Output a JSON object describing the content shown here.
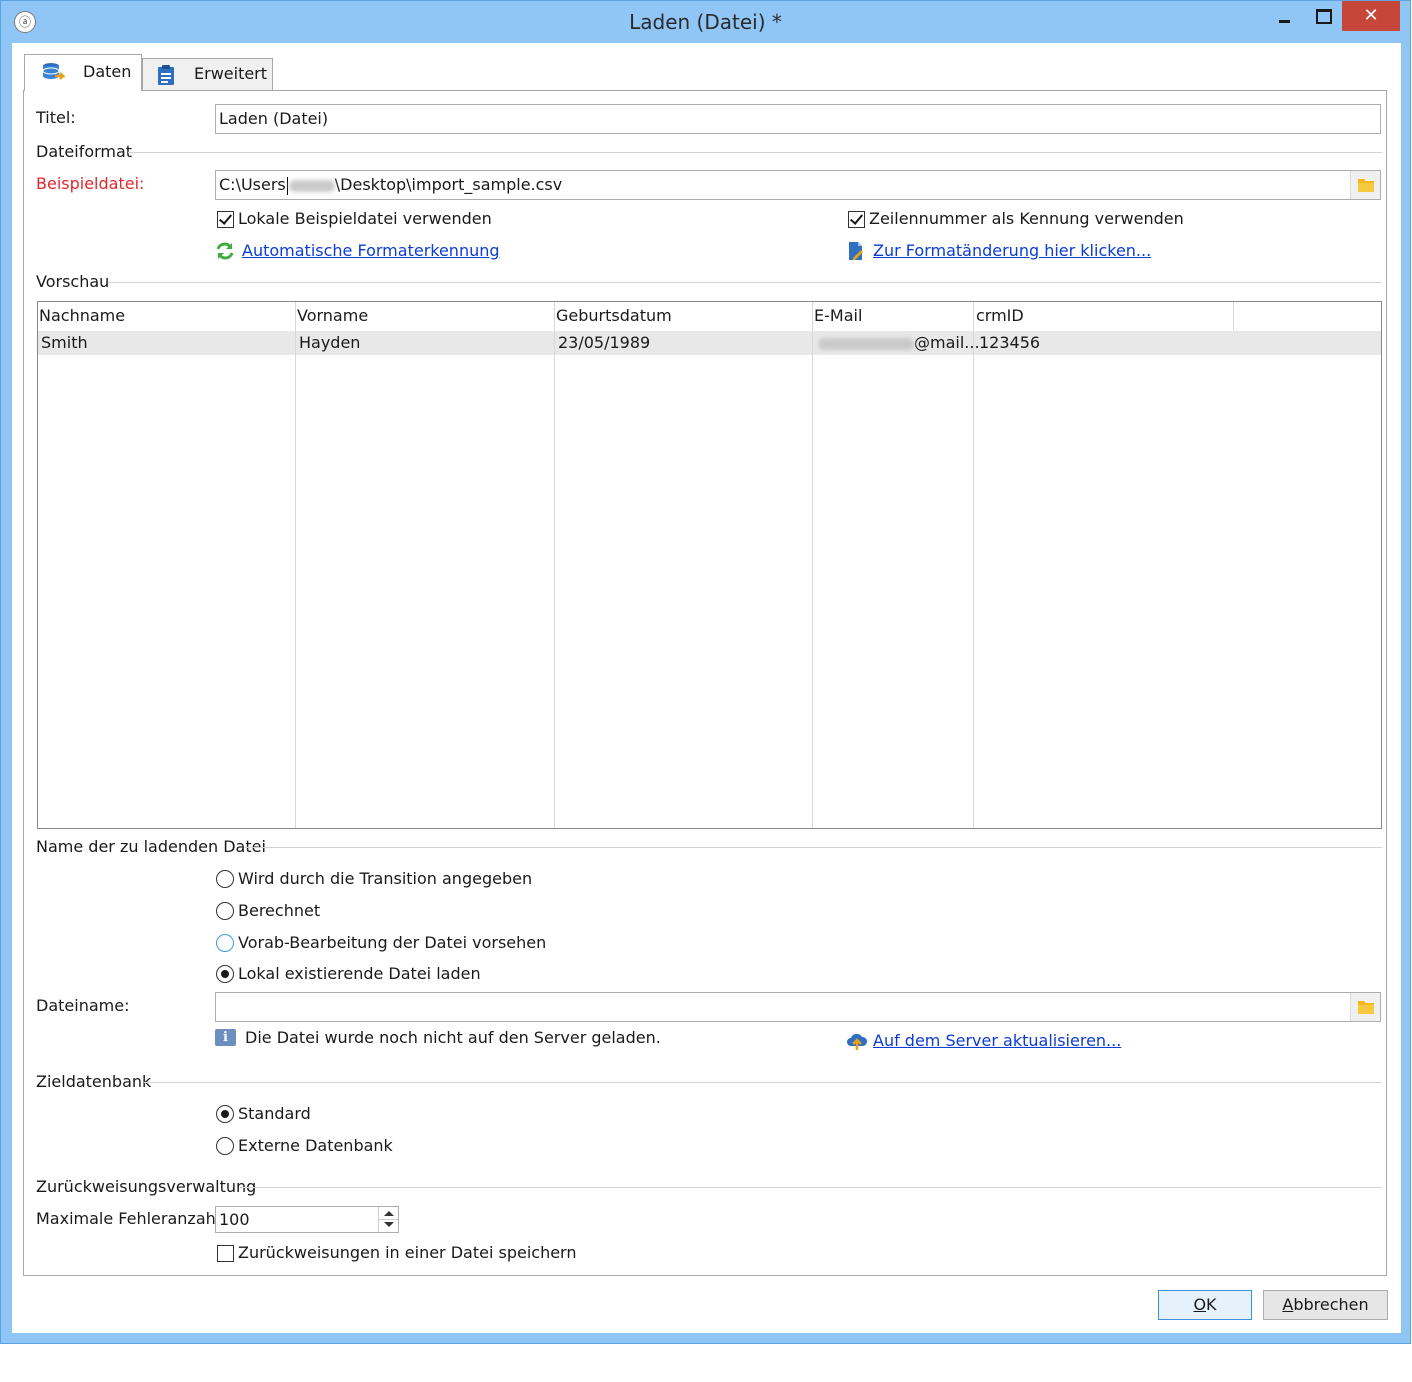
{
  "window": {
    "title": "Laden (Datei) *",
    "app_icon": "acc-logo-icon",
    "close_glyph": "✕"
  },
  "tabs": [
    {
      "label": "Daten",
      "icon": "database-icon",
      "active": true
    },
    {
      "label": "Erweitert",
      "icon": "clipboard-icon",
      "active": false
    }
  ],
  "form": {
    "title_label": "Titel:",
    "title_value": "Laden (Datei)",
    "file_format_section": "Dateiformat",
    "sample_file_label": "Beispieldatei:",
    "sample_file_prefix": "C:\\Users",
    "sample_file_suffix": "\\Desktop\\import_sample.csv",
    "use_local_sample_label": "Lokale Beispieldatei verwenden",
    "use_local_sample_checked": true,
    "line_number_id_label": "Zeilennummer als Kennung verwenden",
    "line_number_id_checked": true,
    "auto_format_link": "Automatische Formaterkennung",
    "format_change_link": "Zur Formatänderung hier klicken...",
    "colors": {
      "required_label": "#e0282f",
      "link": "#0b3cd4",
      "refresh_icon": "#3fae3f",
      "accent": "#8fc6f6"
    }
  },
  "preview": {
    "section": "Vorschau",
    "columns": [
      "Nachname",
      "Vorname",
      "Geburtsdatum",
      "E-Mail",
      "crmID"
    ],
    "rows": [
      {
        "nachname": "Smith",
        "vorname": "Hayden",
        "geburtsdatum": "23/05/1989",
        "email_suffix": "@mail...",
        "crmid": "123456"
      }
    ]
  },
  "file_to_load": {
    "section": "Name der zu ladenden Datei",
    "options": [
      {
        "label": "Wird durch die Transition angegeben",
        "selected": false
      },
      {
        "label": "Berechnet",
        "selected": false
      },
      {
        "label": "Vorab-Bearbeitung der Datei vorsehen",
        "selected": false
      },
      {
        "label": "Lokal existierende Datei laden",
        "selected": true
      }
    ],
    "filename_label": "Dateiname:",
    "filename_value": "",
    "info_text": "Die Datei wurde noch nicht auf den Server geladen.",
    "upload_link": "Auf dem Server aktualisieren..."
  },
  "target_db": {
    "section": "Zieldatenbank",
    "options": [
      {
        "label": "Standard",
        "selected": true
      },
      {
        "label": "Externe Datenbank",
        "selected": false
      }
    ]
  },
  "rejects": {
    "section": "Zurückweisungsverwaltung",
    "max_errors_label": "Maximale Fehleranzahl:",
    "max_errors_value": "100",
    "save_rejects_label": "Zurückweisungen in einer Datei speichern",
    "save_rejects_checked": false
  },
  "buttons": {
    "ok_mnemonic": "O",
    "ok_rest": "K",
    "cancel_mnemonic": "A",
    "cancel_rest": "bbrechen"
  }
}
